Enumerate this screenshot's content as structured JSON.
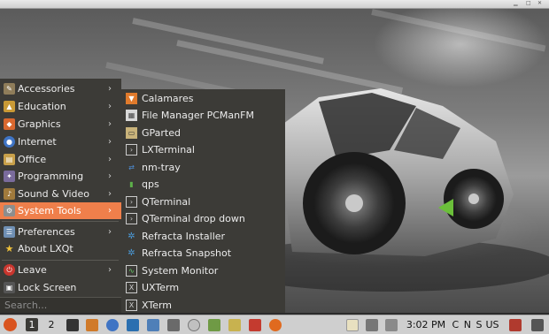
{
  "window": {
    "title": ""
  },
  "menu": {
    "items": [
      {
        "label": "Accessories",
        "icon": "accessories-icon",
        "submenu": true
      },
      {
        "label": "Education",
        "icon": "education-icon",
        "submenu": true
      },
      {
        "label": "Graphics",
        "icon": "graphics-icon",
        "submenu": true
      },
      {
        "label": "Internet",
        "icon": "internet-icon",
        "submenu": true
      },
      {
        "label": "Office",
        "icon": "office-icon",
        "submenu": true
      },
      {
        "label": "Programming",
        "icon": "programming-icon",
        "submenu": true
      },
      {
        "label": "Sound & Video",
        "icon": "sound-video-icon",
        "submenu": true
      },
      {
        "label": "System Tools",
        "icon": "system-tools-icon",
        "submenu": true,
        "active": true
      },
      {
        "label": "Preferences",
        "icon": "preferences-icon",
        "submenu": true
      },
      {
        "label": "About LXQt",
        "icon": "star-icon",
        "submenu": false
      },
      {
        "label": "Leave",
        "icon": "leave-icon",
        "submenu": true
      },
      {
        "label": "Lock Screen",
        "icon": "lock-screen-icon",
        "submenu": false
      }
    ],
    "search_placeholder": "Search..."
  },
  "submenu": {
    "items": [
      {
        "label": "Calamares",
        "icon": "calamares-icon"
      },
      {
        "label": "File Manager PCManFM",
        "icon": "file-manager-icon"
      },
      {
        "label": "GParted",
        "icon": "gparted-icon"
      },
      {
        "label": "LXTerminal",
        "icon": "terminal-icon"
      },
      {
        "label": "nm-tray",
        "icon": "network-icon"
      },
      {
        "label": "qps",
        "icon": "qps-icon"
      },
      {
        "label": "QTerminal",
        "icon": "terminal-icon"
      },
      {
        "label": "QTerminal drop down",
        "icon": "terminal-icon"
      },
      {
        "label": "Refracta Installer",
        "icon": "refracta-icon"
      },
      {
        "label": "Refracta Snapshot",
        "icon": "refracta-icon"
      },
      {
        "label": "System Monitor",
        "icon": "system-monitor-icon"
      },
      {
        "label": "UXTerm",
        "icon": "xterm-icon"
      },
      {
        "label": "XTerm",
        "icon": "xterm-icon"
      }
    ]
  },
  "taskbar": {
    "workspaces": [
      "1",
      "2"
    ],
    "active_workspace": "1",
    "clock": "3:02 PM",
    "keyboard_indicators": "C N S",
    "keyboard_layout": "US"
  }
}
